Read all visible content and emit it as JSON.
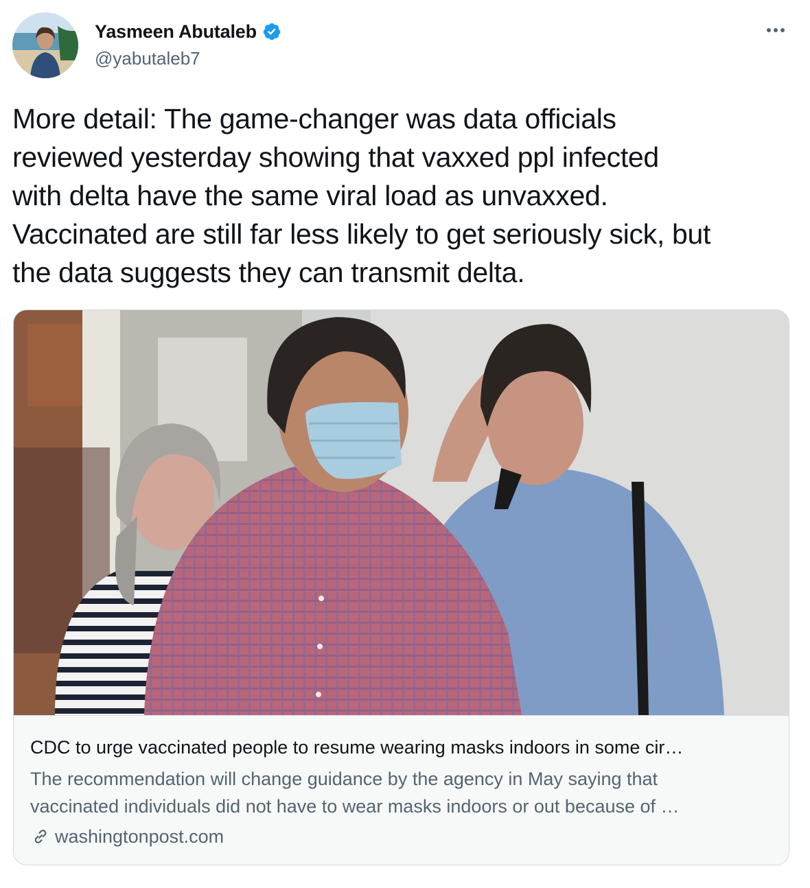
{
  "author": {
    "display_name": "Yasmeen Abutaleb",
    "handle": "@yabutaleb7",
    "verified": true,
    "avatar_icon": "profile-photo",
    "verified_icon": "verified-badge-icon",
    "verified_color": "#1d9bf0"
  },
  "menu": {
    "icon": "more-options-icon"
  },
  "tweet": {
    "lines": [
      "More detail: The game-changer was data officials",
      "reviewed yesterday showing that vaxxed ppl infected",
      "with delta have the same viral load as unvaxxed.",
      "Vaccinated are still far less likely to get seriously sick, but",
      "the data suggests they can transmit delta."
    ]
  },
  "link_card": {
    "image_icon": "article-photo",
    "title": "CDC to urge vaccinated people to resume wearing masks indoors in some cir…",
    "description_lines": [
      "The recommendation will change guidance by the agency in May saying that",
      "vaccinated individuals did not have to wear masks indoors or out because of …"
    ],
    "domain": "washingtonpost.com",
    "domain_icon": "link-icon"
  },
  "colors": {
    "text_primary": "#0f1419",
    "text_secondary": "#536471",
    "border": "#cfd9de",
    "card_background": "#f7f9f9",
    "accent": "#1d9bf0"
  }
}
